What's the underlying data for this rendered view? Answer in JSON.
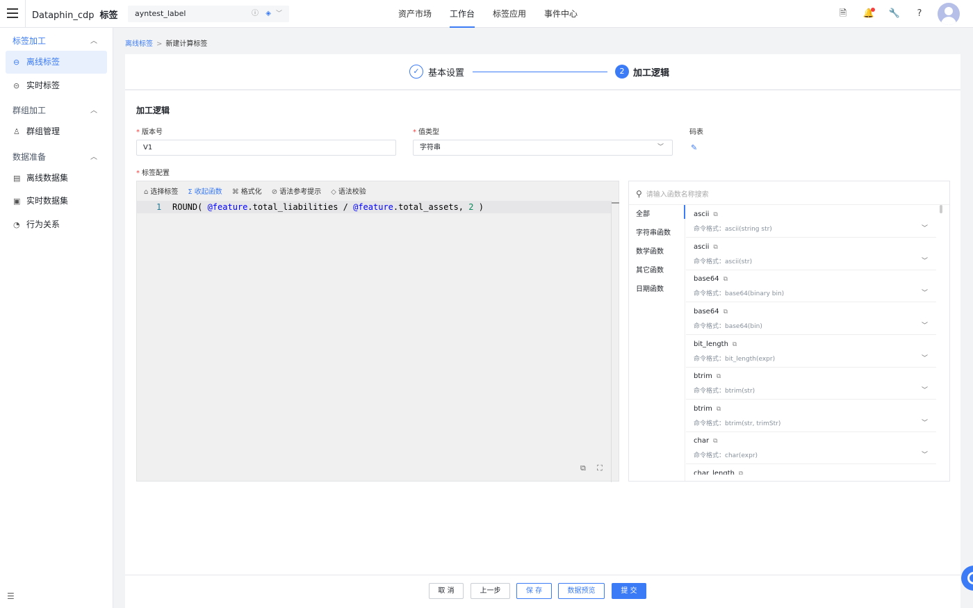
{
  "topbar": {
    "app_name": "Dataphin_cdp",
    "module": "标签",
    "project": "ayntest_label",
    "nav": [
      "资产市场",
      "工作台",
      "标签应用",
      "事件中心"
    ]
  },
  "sidebar": {
    "group1": "标签加工",
    "item_offline": "离线标签",
    "item_realtime": "实时标签",
    "group2": "群组加工",
    "item_group": "群组管理",
    "group3": "数据准备",
    "item_offline_ds": "离线数据集",
    "item_realtime_ds": "实时数据集",
    "item_behavior": "行为关系"
  },
  "breadcrumb": {
    "link": "离线标签",
    "current": "新建计算标签"
  },
  "steps": {
    "step1": "基本设置",
    "step2_num": "2",
    "step2": "加工逻辑"
  },
  "form": {
    "section_title": "加工逻辑",
    "version_label": "版本号",
    "version_value": "V1",
    "type_label": "值类型",
    "type_value": "字符串",
    "code_table_label": "码表",
    "config_label": "标签配置"
  },
  "editor": {
    "toolbar": [
      "选择标签",
      "收起函数",
      "格式化",
      "语法参考提示",
      "语法校验"
    ],
    "line_number": "1",
    "code_prefix": "ROUND( ",
    "kw1": "@feature",
    "code_mid": ".total_liabilities / ",
    "kw2": "@feature",
    "code_mid2": ".total_assets, ",
    "num": "2",
    "code_suffix": " )"
  },
  "functions": {
    "search_placeholder": "请输入函数名称搜索",
    "categories": [
      "全部",
      "字符串函数",
      "数学函数",
      "其它函数",
      "日期函数"
    ],
    "fmt_prefix": "命令格式：",
    "items": [
      {
        "name": "ascii",
        "fmt": "ascii(string str)"
      },
      {
        "name": "ascii",
        "fmt": "ascii(str)"
      },
      {
        "name": "base64",
        "fmt": "base64(binary bin)"
      },
      {
        "name": "base64",
        "fmt": "base64(bin)"
      },
      {
        "name": "bit_length",
        "fmt": "bit_length(expr)"
      },
      {
        "name": "btrim",
        "fmt": "btrim(str)"
      },
      {
        "name": "btrim",
        "fmt": "btrim(str, trimStr)"
      },
      {
        "name": "char",
        "fmt": "char(expr)"
      },
      {
        "name": "char_length",
        "fmt": ""
      }
    ]
  },
  "footer": {
    "cancel": "取 消",
    "prev": "上一步",
    "save": "保 存",
    "preview": "数据预览",
    "submit": "提 交"
  }
}
